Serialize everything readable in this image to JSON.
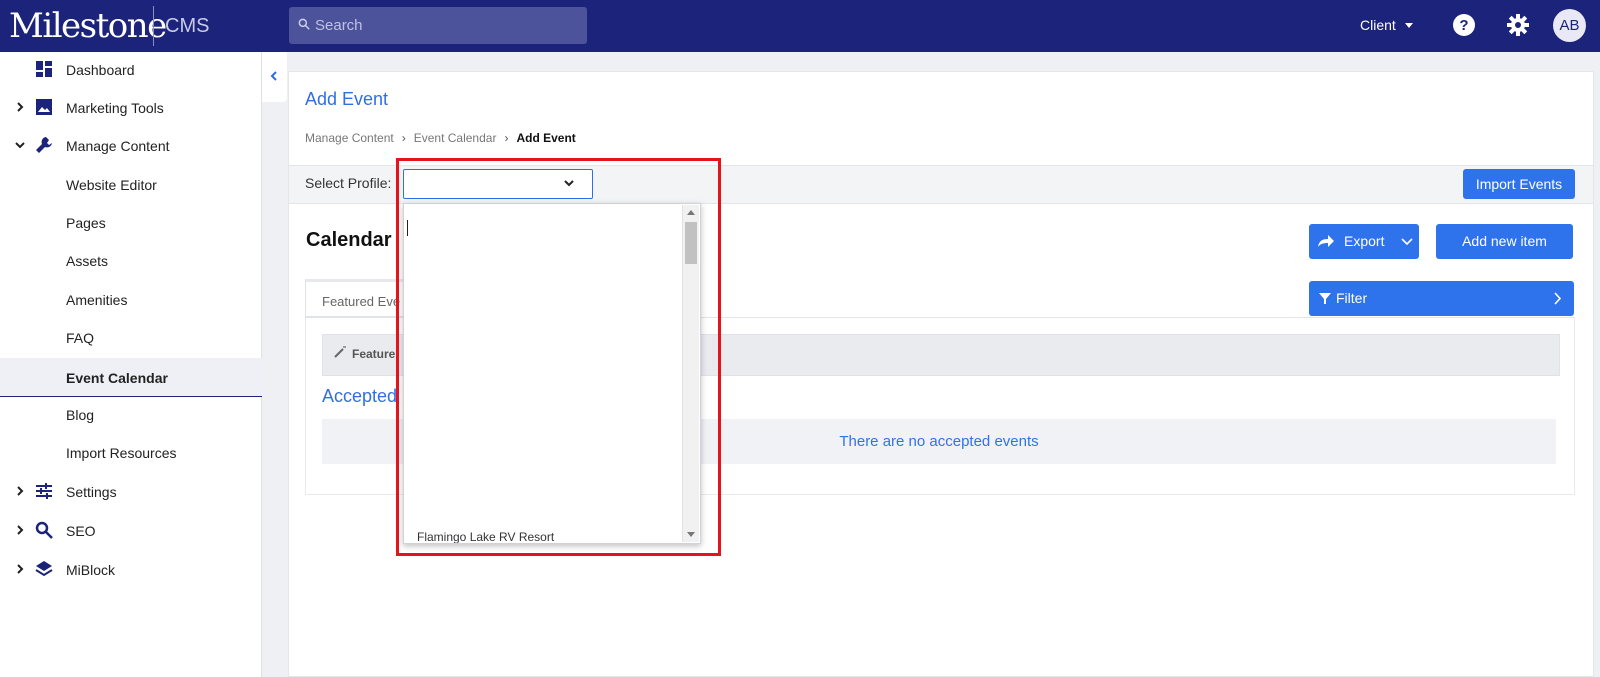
{
  "header": {
    "logo": "Milestone",
    "product": "CMS",
    "search_placeholder": "Search",
    "client_label": "Client",
    "avatar_initials": "AB",
    "colors": {
      "topbar": "#1b237a",
      "accent": "#2f73ec"
    }
  },
  "sidebar": {
    "items": [
      {
        "label": "Dashboard",
        "icon": "dashboard-icon",
        "expandable": false
      },
      {
        "label": "Marketing Tools",
        "icon": "image-icon",
        "expandable": true,
        "expanded": false
      },
      {
        "label": "Manage Content",
        "icon": "wrench-icon",
        "expandable": true,
        "expanded": true
      },
      {
        "label": "Website Editor",
        "sub": true
      },
      {
        "label": "Pages",
        "sub": true
      },
      {
        "label": "Assets",
        "sub": true
      },
      {
        "label": "Amenities",
        "sub": true
      },
      {
        "label": "FAQ",
        "sub": true
      },
      {
        "label": "Event Calendar",
        "sub": true,
        "active": true
      },
      {
        "label": "Blog",
        "sub": true
      },
      {
        "label": "Import Resources",
        "sub": true
      },
      {
        "label": "Settings",
        "icon": "sliders-icon",
        "expandable": true,
        "expanded": false
      },
      {
        "label": "SEO",
        "icon": "search-icon",
        "expandable": true,
        "expanded": false
      },
      {
        "label": "MiBlock",
        "icon": "layers-icon",
        "expandable": true,
        "expanded": false
      }
    ]
  },
  "main": {
    "title": "Add Event",
    "breadcrumb": [
      "Manage Content",
      "Event Calendar",
      "Add Event"
    ],
    "profile_label": "Select Profile:",
    "profile_value": "",
    "import_button": "Import Events",
    "calendar_title": "Calendar",
    "export_button": "Export",
    "add_button": "Add new item",
    "filter_button": "Filter",
    "tab_label": "Featured Eve",
    "featured_label": "Feature",
    "accepted_title": "Accepted",
    "empty_message": "There are no accepted events"
  },
  "dropdown": {
    "visible_option": "Flamingo Lake RV Resort"
  }
}
